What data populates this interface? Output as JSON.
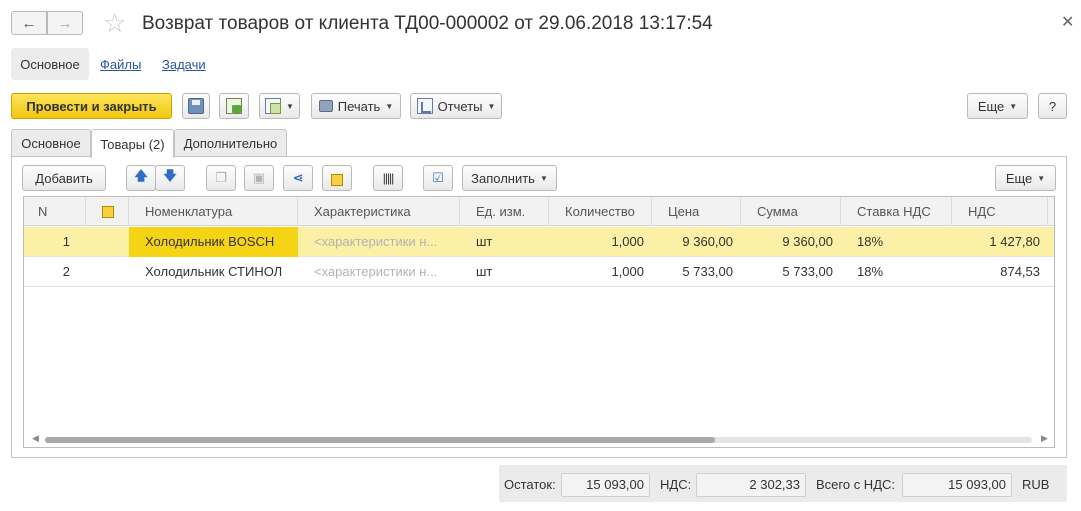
{
  "window": {
    "title": "Возврат товаров от клиента ТД00-000002 от 29.06.2018 13:17:54",
    "back_icon": "arrow-left-icon",
    "forward_icon": "arrow-right-icon",
    "favorite_icon": "star-icon",
    "close_icon": "close-icon"
  },
  "sections": {
    "main": "Основное",
    "files": "Файлы",
    "tasks": "Задачи"
  },
  "toolbar": {
    "post_close": "Провести и закрыть",
    "print": "Печать",
    "reports": "Отчеты",
    "more": "Еще",
    "help": "?"
  },
  "tabs": {
    "main": "Основное",
    "goods": "Товары (2)",
    "additional": "Дополнительно"
  },
  "table_toolbar": {
    "add": "Добавить",
    "fill": "Заполнить",
    "more": "Еще"
  },
  "table": {
    "columns": [
      "N",
      "",
      "Номенклатура",
      "Характеристика",
      "Ед. изм.",
      "Количество",
      "Цена",
      "Сумма",
      "Ставка НДС",
      "НДС"
    ],
    "rows": [
      {
        "n": "1",
        "item": "Холодильник BOSCH",
        "characteristic": "<характеристики н...",
        "unit": "шт",
        "qty": "1,000",
        "price": "9 360,00",
        "sum": "9 360,00",
        "vat_rate": "18%",
        "vat": "1 427,80"
      },
      {
        "n": "2",
        "item": "Холодильник СТИНОЛ",
        "characteristic": "<характеристики н...",
        "unit": "шт",
        "qty": "1,000",
        "price": "5 733,00",
        "sum": "5 733,00",
        "vat_rate": "18%",
        "vat": "874,53"
      }
    ]
  },
  "totals": {
    "balance_label": "Остаток:",
    "balance": "15 093,00",
    "vat_label": "НДС:",
    "vat": "2 302,33",
    "total_label": "Всего с НДС:",
    "total": "15 093,00",
    "currency": "RUB"
  },
  "colors": {
    "primary_button": "#f5d416",
    "selected_row": "#fbf0a6",
    "link": "#2a55a0"
  }
}
